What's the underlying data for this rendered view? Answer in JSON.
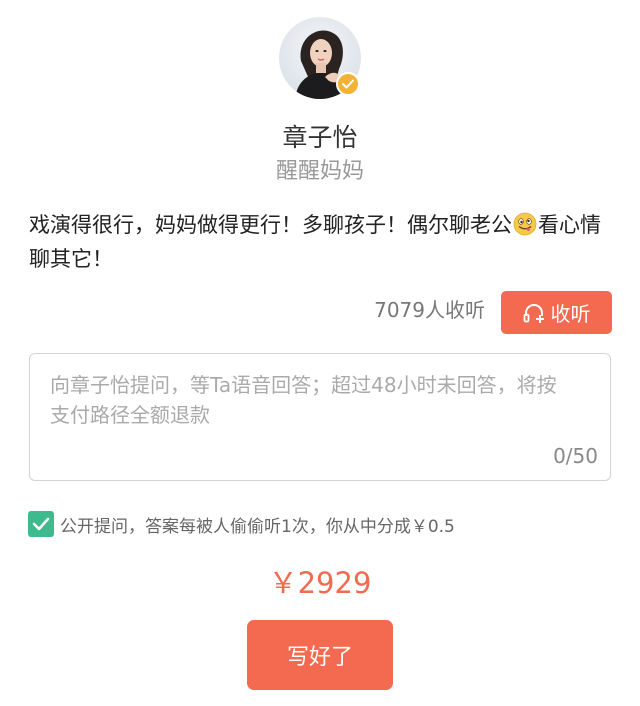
{
  "profile": {
    "name": "章子怡",
    "subtitle": "醒醒妈妈",
    "avatar_icon": "avatar",
    "verified_icon": "verified-check-icon"
  },
  "bio": {
    "text_before_emoji": "戏演得很行，妈妈做得更行！多聊孩子！偶尔聊老公",
    "emoji": "winking-tongue-face-emoji",
    "text_after_emoji": "看心情聊其它！"
  },
  "listen": {
    "count_text": "7079人收听",
    "button_label": "收听",
    "button_icon": "headphones-plus-icon"
  },
  "question": {
    "placeholder": "向章子怡提问，等Ta语音回答；超过48小时未回答，将按支付路径全额退款",
    "value": "",
    "char_count": "0/50"
  },
  "public_option": {
    "checked": true,
    "label": "公开提问，答案每被人偷偷听1次，你从中分成￥0.5"
  },
  "price": {
    "text": "￥2929"
  },
  "submit": {
    "label": "写好了"
  },
  "colors": {
    "accent": "#f46a50",
    "check_green": "#3dba8e",
    "verified_gold": "#f3b232"
  }
}
